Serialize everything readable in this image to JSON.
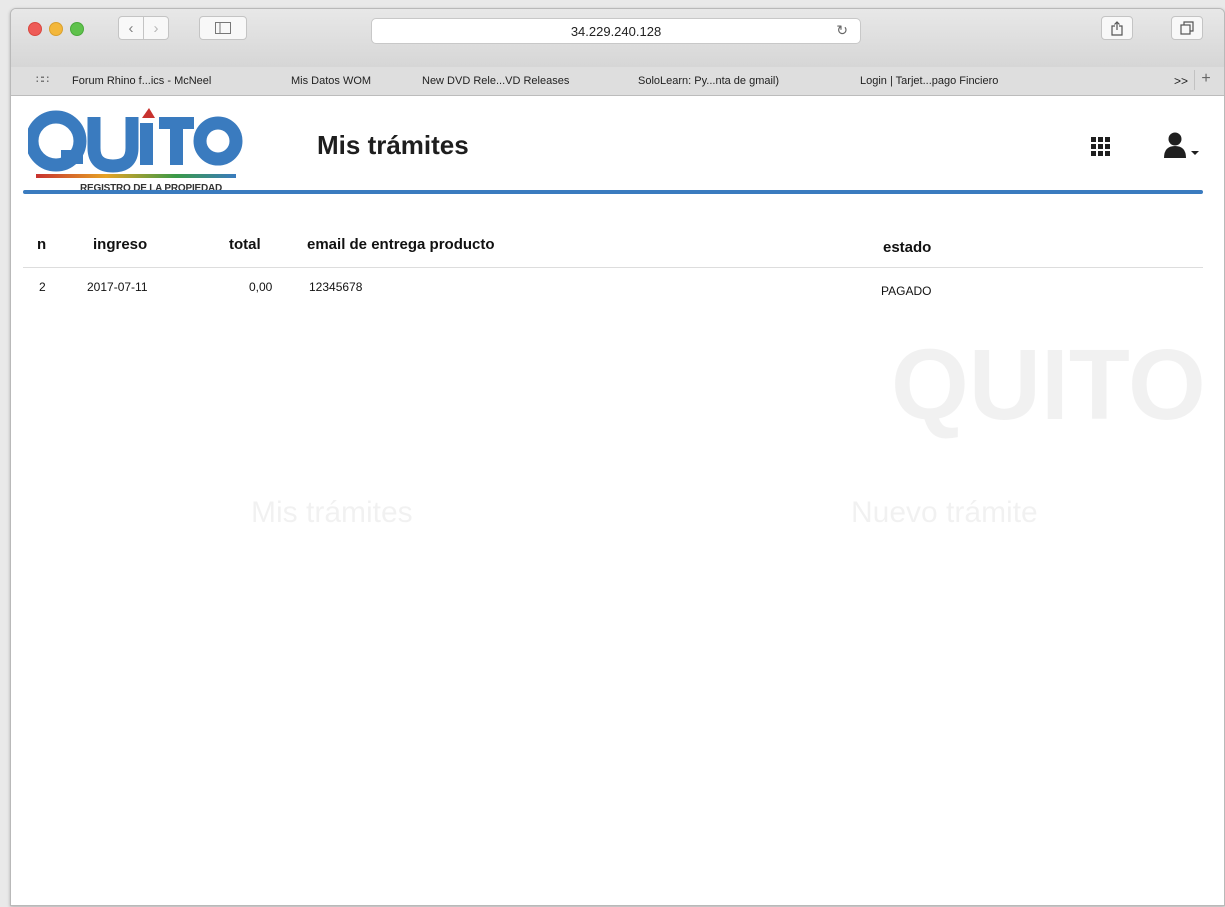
{
  "browser": {
    "address": "34.229.240.128",
    "bookmarks": [
      "Forum Rhino f...ics - McNeel",
      "Mis Datos WOM",
      "New DVD Rele...VD Releases",
      "SoloLearn: Py...nta de gmail)",
      "Login | Tarjet...pago Finciero"
    ],
    "bookmarks_more": ">>",
    "bookmarks_add": "+"
  },
  "header": {
    "logo_text": "QUITO",
    "logo_subtitle": "REGISTRO DE LA PROPIEDAD",
    "title": "Mis trámites",
    "accent_color": "#3a7bbf",
    "icons": [
      "apps-grid-icon",
      "user-icon"
    ]
  },
  "table": {
    "columns": [
      "n",
      "ingreso",
      "total",
      "email de entrega producto",
      "estado"
    ],
    "rows": [
      {
        "n": "2",
        "ingreso": "2017-07-11",
        "total": "0,00",
        "email": "12345678",
        "estado": "PAGADO"
      }
    ]
  },
  "ghost": {
    "nuevo": "Nuevo trámite",
    "mis": "Mis trámites"
  }
}
